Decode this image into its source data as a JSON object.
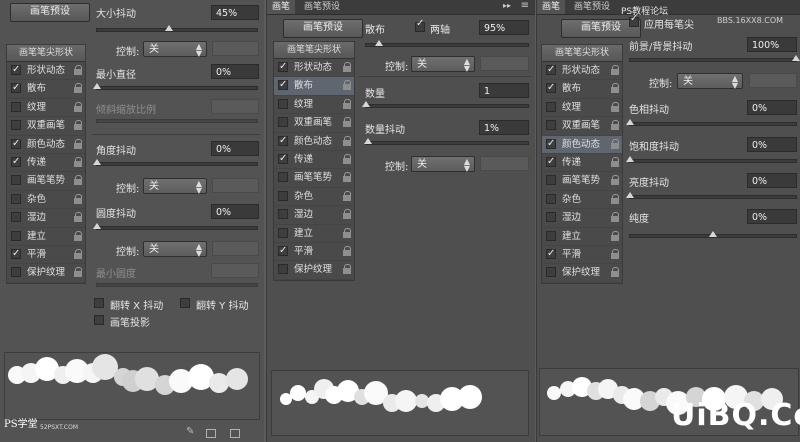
{
  "panel1": {
    "preset_button": "画笔预设",
    "list_header": "画笔笔尖形状",
    "items": [
      {
        "label": "形状动态",
        "checked": true,
        "selected": false
      },
      {
        "label": "散布",
        "checked": true,
        "selected": false
      },
      {
        "label": "纹理",
        "checked": false,
        "selected": false
      },
      {
        "label": "双重画笔",
        "checked": false,
        "selected": false
      },
      {
        "label": "颜色动态",
        "checked": true,
        "selected": false
      },
      {
        "label": "传递",
        "checked": true,
        "selected": false
      },
      {
        "label": "画笔笔势",
        "checked": false,
        "selected": false
      },
      {
        "label": "杂色",
        "checked": false,
        "selected": false
      },
      {
        "label": "湿边",
        "checked": false,
        "selected": false
      },
      {
        "label": "建立",
        "checked": false,
        "selected": false
      },
      {
        "label": "平滑",
        "checked": true,
        "selected": false
      },
      {
        "label": "保护纹理",
        "checked": false,
        "selected": false
      }
    ],
    "size_jitter_label": "大小抖动",
    "size_jitter_value": "45%",
    "control_label": "控制:",
    "control_value": "关",
    "min_diameter_label": "最小直径",
    "min_diameter_value": "0%",
    "tilt_scale_label": "倾斜缩放比例",
    "angle_jitter_label": "角度抖动",
    "angle_jitter_value": "0%",
    "roundness_jitter_label": "圆度抖动",
    "roundness_jitter_value": "0%",
    "min_roundness_label": "最小圆度",
    "flip_x_label": "翻转 X 抖动",
    "flip_y_label": "翻转 Y 抖动",
    "brush_projection_label": "画笔投影",
    "watermark": "PS学堂",
    "watermark_url": "52PSXT.COM"
  },
  "panel2": {
    "tab_brush": "画笔",
    "tab_presets": "画笔预设",
    "preset_button": "画笔预设",
    "list_header": "画笔笔尖形状",
    "items": [
      {
        "label": "形状动态",
        "checked": true,
        "selected": false
      },
      {
        "label": "散布",
        "checked": true,
        "selected": true
      },
      {
        "label": "纹理",
        "checked": false,
        "selected": false
      },
      {
        "label": "双重画笔",
        "checked": false,
        "selected": false
      },
      {
        "label": "颜色动态",
        "checked": true,
        "selected": false
      },
      {
        "label": "传递",
        "checked": true,
        "selected": false
      },
      {
        "label": "画笔笔势",
        "checked": false,
        "selected": false
      },
      {
        "label": "杂色",
        "checked": false,
        "selected": false
      },
      {
        "label": "湿边",
        "checked": false,
        "selected": false
      },
      {
        "label": "建立",
        "checked": false,
        "selected": false
      },
      {
        "label": "平滑",
        "checked": true,
        "selected": false
      },
      {
        "label": "保护纹理",
        "checked": false,
        "selected": false
      }
    ],
    "scatter_label": "散布",
    "both_axes_label": "两轴",
    "scatter_value": "95%",
    "control_label": "控制:",
    "control_value": "关",
    "count_label": "数量",
    "count_value": "1",
    "count_jitter_label": "数量抖动",
    "count_jitter_value": "1%"
  },
  "panel3": {
    "tab_brush": "画笔",
    "tab_presets": "画笔预设",
    "preset_button": "画笔预设",
    "apply_per_tip_label": "应用每笔尖",
    "list_header": "画笔笔尖形状",
    "items": [
      {
        "label": "形状动态",
        "checked": true,
        "selected": false
      },
      {
        "label": "散布",
        "checked": true,
        "selected": false
      },
      {
        "label": "纹理",
        "checked": false,
        "selected": false
      },
      {
        "label": "双重画笔",
        "checked": false,
        "selected": false
      },
      {
        "label": "颜色动态",
        "checked": true,
        "selected": true
      },
      {
        "label": "传递",
        "checked": true,
        "selected": false
      },
      {
        "label": "画笔笔势",
        "checked": false,
        "selected": false
      },
      {
        "label": "杂色",
        "checked": false,
        "selected": false
      },
      {
        "label": "湿边",
        "checked": false,
        "selected": false
      },
      {
        "label": "建立",
        "checked": false,
        "selected": false
      },
      {
        "label": "平滑",
        "checked": true,
        "selected": false
      },
      {
        "label": "保护纹理",
        "checked": false,
        "selected": false
      }
    ],
    "fg_bg_jitter_label": "前景/背景抖动",
    "fg_bg_jitter_value": "100%",
    "control_label": "控制:",
    "control_value": "关",
    "hue_jitter_label": "色相抖动",
    "hue_jitter_value": "0%",
    "saturation_jitter_label": "饱和度抖动",
    "saturation_jitter_value": "0%",
    "brightness_jitter_label": "亮度抖动",
    "brightness_jitter_value": "0%",
    "purity_label": "纯度",
    "purity_value": "0%",
    "watermark_top": "PS教程论坛",
    "watermark_top_url": "BBS.16XX8.COM",
    "watermark_bottom": "UiBQ.CoM"
  },
  "colors": {
    "panel_bg": "#535353",
    "field_bg": "#3a3a3a",
    "selected_row": "#5f6670",
    "brush_dot": "#ffffff"
  }
}
